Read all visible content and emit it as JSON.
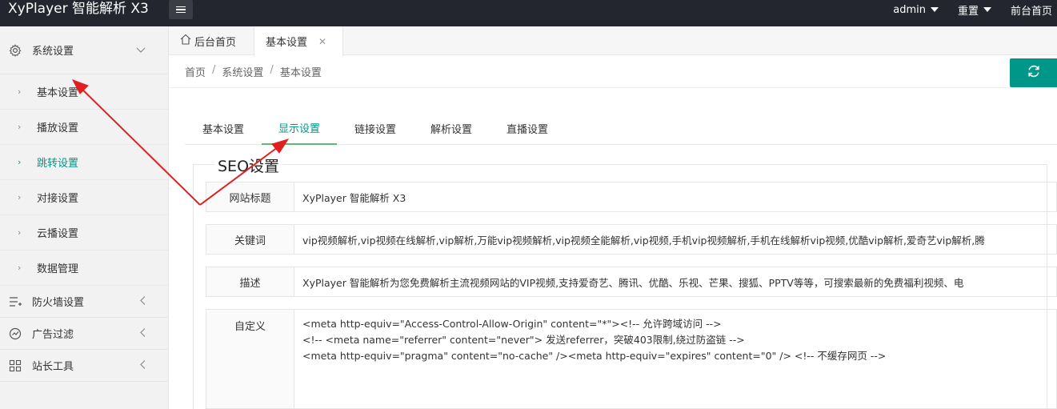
{
  "header": {
    "brand": "XyPlayer 智能解析 X3",
    "user_label": "admin",
    "reset_label": "重置",
    "frontend_label": "前台首页"
  },
  "sidebar": {
    "groups": [
      {
        "label": "系统设置",
        "icon": "gear-icon"
      },
      {
        "label": "防火墙设置",
        "icon": "list-icon"
      },
      {
        "label": "广告过滤",
        "icon": "gauge-icon"
      },
      {
        "label": "站长工具",
        "icon": "grid-icon"
      }
    ],
    "items": [
      {
        "label": "基本设置"
      },
      {
        "label": "播放设置"
      },
      {
        "label": "跳转设置"
      },
      {
        "label": "对接设置"
      },
      {
        "label": "云播设置"
      },
      {
        "label": "数据管理"
      }
    ]
  },
  "tabs": {
    "home": "后台首页",
    "current": "基本设置"
  },
  "breadcrumb": [
    "首页",
    "系统设置",
    "基本设置"
  ],
  "settings_tabs": [
    "基本设置",
    "显示设置",
    "链接设置",
    "解析设置",
    "直播设置"
  ],
  "section": {
    "legend": "SEO设置",
    "fields": [
      {
        "label": "网站标题",
        "value": "XyPlayer 智能解析 X3"
      },
      {
        "label": "关键词",
        "value": "vip视频解析,vip视频在线解析,vip解析,万能vip视频解析,vip视频全能解析,vip视频,手机vip视频解析,手机在线解析vip视频,优酷vip解析,爱奇艺vip解析,腾"
      },
      {
        "label": "描述",
        "value": "XyPlayer 智能解析为您免费解析主流视频网站的VIP视频,支持爱奇艺、腾讯、优酷、乐视、芒果、搜狐、PPTV等等，可搜索最新的免费福利视频、电"
      },
      {
        "label": "自定义",
        "lines": [
          "<meta http-equiv=\"Access-Control-Allow-Origin\" content=\"*\"><!-- 允许跨域访问 -->",
          "<!-- <meta name=\"referrer\" content=\"never\"> 发送referrer，突破403限制,绕过防盗链 -->",
          "<meta http-equiv=\"pragma\" content=\"no-cache\" /><meta http-equiv=\"expires\" content=\"0\" />    <!-- 不缓存网页 -->"
        ]
      }
    ]
  },
  "colors": {
    "accent": "#009688",
    "header_bg": "#23262e",
    "annotation": "#e02020"
  }
}
